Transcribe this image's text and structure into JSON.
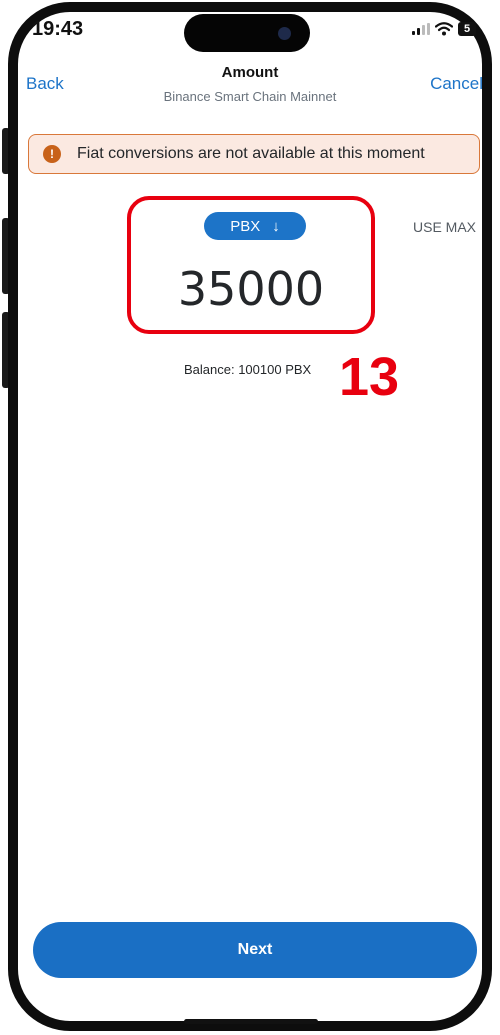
{
  "status_bar": {
    "time": "19:43",
    "battery": "5"
  },
  "nav": {
    "back_label": "Back",
    "title": "Amount",
    "subtitle": "Binance Smart Chain Mainnet",
    "cancel_label": "Cancel"
  },
  "banner": {
    "icon": "info-icon",
    "icon_glyph": "!",
    "text": "Fiat conversions are not available at this moment",
    "background": "#fbe9e1",
    "border": "#d9783a"
  },
  "amount": {
    "token_symbol": "PBX",
    "token_selector_icon": "arrow-down-icon",
    "token_selector_glyph": "↓",
    "value": "35000",
    "use_max_label": "USE MAX",
    "balance_text": "Balance: 100100 PBX"
  },
  "annotation": {
    "step_number": "13",
    "color": "#e8000f"
  },
  "footer": {
    "next_label": "Next"
  },
  "colors": {
    "accent": "#1d74c8",
    "text": "#24272a",
    "muted": "#6a737d"
  }
}
